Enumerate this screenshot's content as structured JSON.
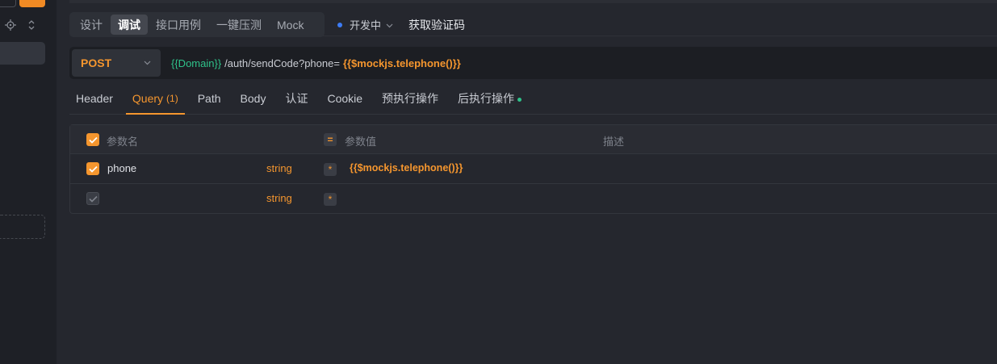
{
  "mode_tabs": [
    {
      "label": "设计"
    },
    {
      "label": "调试"
    },
    {
      "label": "接口用例"
    },
    {
      "label": "一键压测"
    },
    {
      "label": "Mock"
    }
  ],
  "environment": {
    "label": "开发中",
    "dot_color": "#3d7cf5"
  },
  "api_title": "获取验证码",
  "request": {
    "method": "POST",
    "url_env_var": "{{Domain}}",
    "url_path": "/auth/sendCode?phone=",
    "url_mock_var": "{{$mockjs.telephone()}}"
  },
  "request_tabs": [
    {
      "label": "Header"
    },
    {
      "label": "Query",
      "count": "(1)"
    },
    {
      "label": "Path"
    },
    {
      "label": "Body"
    },
    {
      "label": "认证"
    },
    {
      "label": "Cookie"
    },
    {
      "label": "预执行操作"
    },
    {
      "label": "后执行操作"
    }
  ],
  "params_table": {
    "headers": {
      "name": "参数名",
      "value_badge": "=",
      "value": "参数值",
      "desc": "描述"
    },
    "rows": [
      {
        "name": "phone",
        "type": "string",
        "required_mark": "*",
        "value": "{{$mockjs.telephone()}}"
      },
      {
        "name": "",
        "type": "string",
        "required_mark": "*",
        "value": ""
      }
    ]
  },
  "colors": {
    "accent": "#f5962e",
    "env_var": "#2fc28a",
    "background": "#25272e"
  }
}
